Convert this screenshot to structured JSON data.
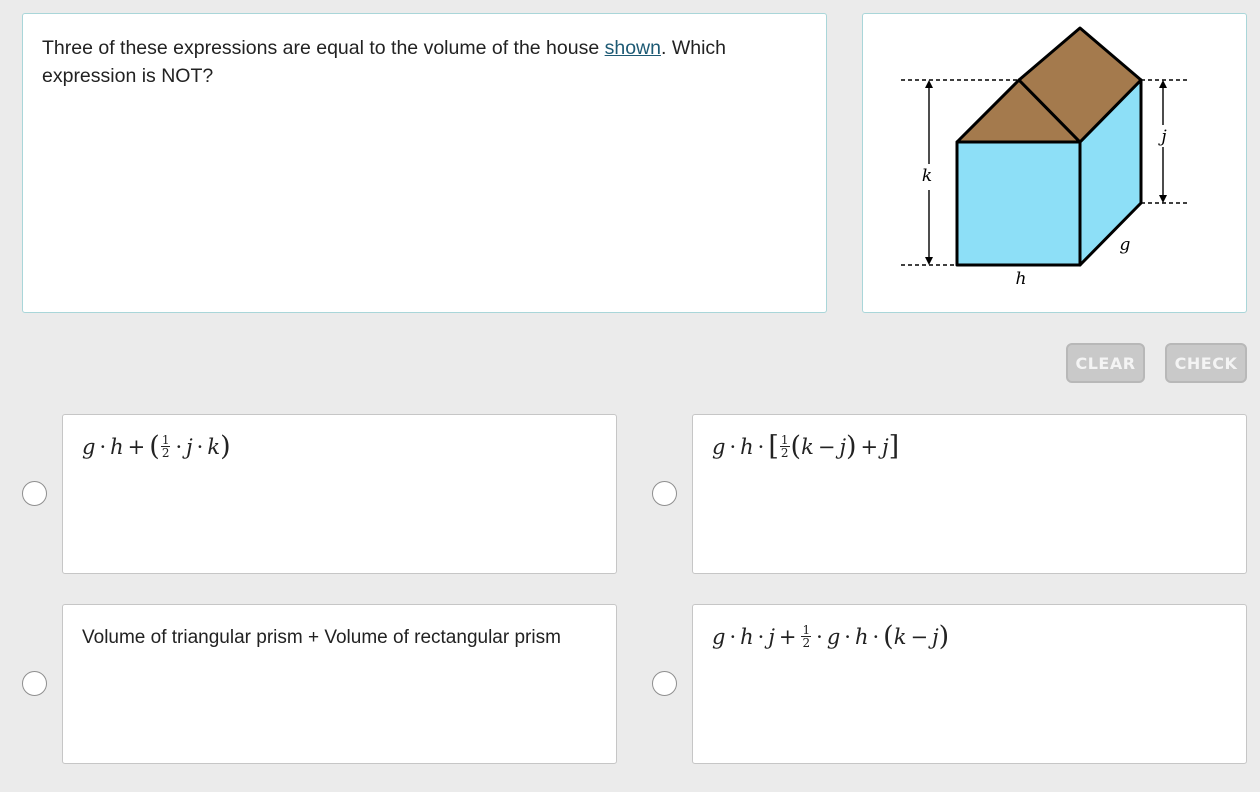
{
  "question": {
    "text_before": "Three of these expressions are equal to the volume of the house ",
    "link_text": "shown",
    "text_after": ". Which expression is NOT?"
  },
  "figure": {
    "labels": {
      "k": "k",
      "j": "j",
      "g": "g",
      "h": "h"
    },
    "colors": {
      "walls": "#8ddff7",
      "roof": "#a47a4d",
      "outline": "#000000"
    }
  },
  "buttons": {
    "clear": "CLEAR",
    "check": "CHECK"
  },
  "options": {
    "a": {
      "g": "g",
      "dot1": "·",
      "h": "h",
      "plus": "+",
      "lparen": "(",
      "num": "1",
      "den": "2",
      "dot2": "·",
      "j": "j",
      "dot3": "·",
      "k": "k",
      "rparen": ")"
    },
    "b": {
      "g": "g",
      "dot1": "·",
      "h": "h",
      "dot2": "·",
      "lbrack": "[",
      "num": "1",
      "den": "2",
      "lparen": "(",
      "k": "k",
      "minus": "−",
      "j1": "j",
      "rparen": ")",
      "plus": "+",
      "j2": "j",
      "rbrack": "]"
    },
    "c": {
      "text": "Volume of triangular prism + Volume of rectangular prism"
    },
    "d": {
      "g1": "g",
      "dot1": "·",
      "h1": "h",
      "dot2": "·",
      "j1": "j",
      "plus": "+",
      "num": "1",
      "den": "2",
      "dot3": "·",
      "g2": "g",
      "dot4": "·",
      "h2": "h",
      "dot5": "·",
      "lparen": "(",
      "k": "k",
      "minus": "−",
      "j2": "j",
      "rparen": ")"
    }
  }
}
